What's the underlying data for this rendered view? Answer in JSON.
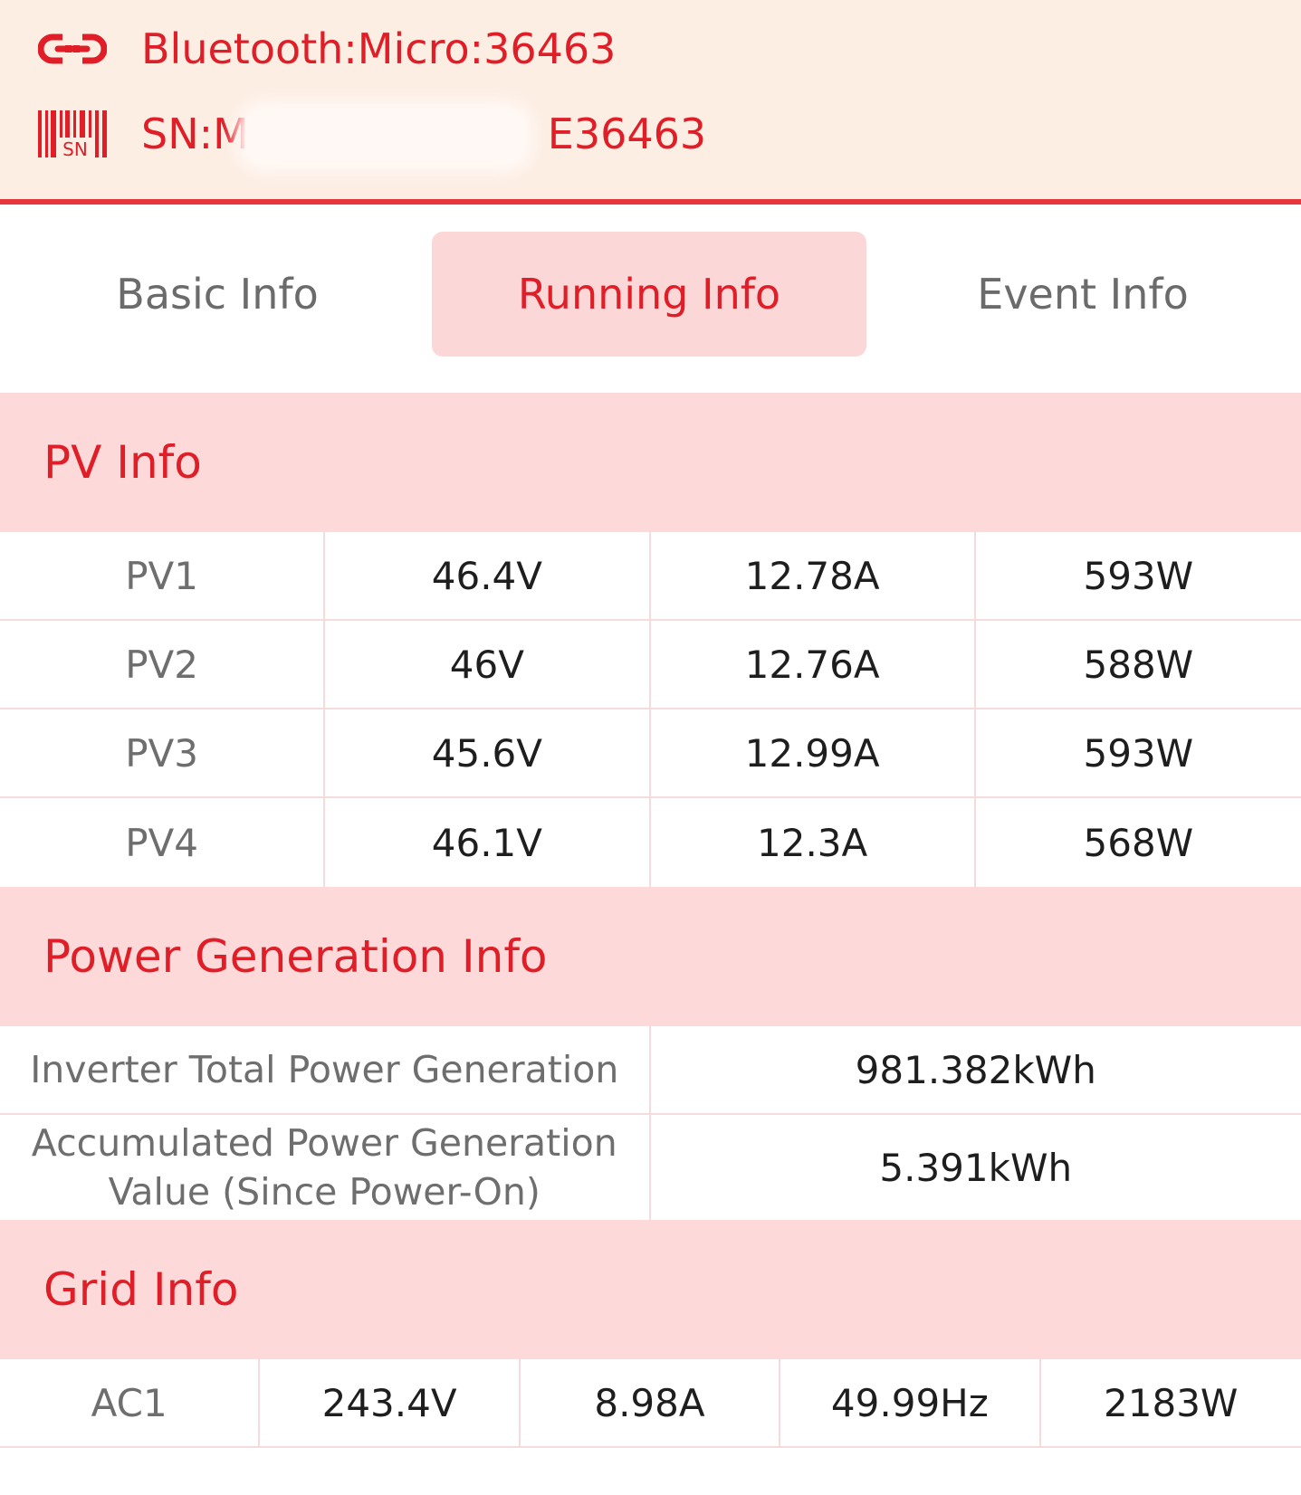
{
  "header": {
    "bluetooth_label": "Bluetooth:Micro:36463",
    "sn_label": "SN:M",
    "sn_suffix": "E36463",
    "link_icon": "link-icon",
    "barcode_icon": "sn-barcode-icon",
    "accent_color": "#e01e28",
    "background_color": "#fdeee4"
  },
  "tabs": [
    {
      "label": "Basic Info",
      "active": false
    },
    {
      "label": "Running Info",
      "active": true
    },
    {
      "label": "Event Info",
      "active": false
    }
  ],
  "pv_info": {
    "title": "PV Info",
    "rows": [
      {
        "name": "PV1",
        "voltage": "46.4V",
        "current": "12.78A",
        "power": "593W"
      },
      {
        "name": "PV2",
        "voltage": "46V",
        "current": "12.76A",
        "power": "588W"
      },
      {
        "name": "PV3",
        "voltage": "45.6V",
        "current": "12.99A",
        "power": "593W"
      },
      {
        "name": "PV4",
        "voltage": "46.1V",
        "current": "12.3A",
        "power": "568W"
      }
    ]
  },
  "power_generation": {
    "title": "Power Generation Info",
    "rows": [
      {
        "label": "Inverter Total Power Generation",
        "value": "981.382kWh"
      },
      {
        "label": "Accumulated Power Generation Value (Since Power-On)",
        "value": "5.391kWh"
      }
    ]
  },
  "grid_info": {
    "title": "Grid Info",
    "rows": [
      {
        "name": "AC1",
        "voltage": "243.4V",
        "current": "8.98A",
        "frequency": "49.99Hz",
        "power": "2183W"
      }
    ]
  }
}
